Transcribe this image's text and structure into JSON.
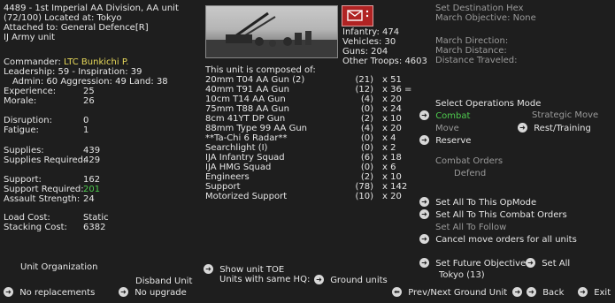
{
  "header": {
    "line1": "4489 - 1st Imperial AA Division, AA unit",
    "line2": "(72/100) Located at: Tokyo",
    "line3": "Attached to:  General Defence[R]",
    "line4": "IJ Army unit"
  },
  "commander": {
    "label": "Commander:",
    "name": "LTC Bunkichi P.",
    "leadership": "Leadership: 59 - Inspiration: 39",
    "admin": "Admin: 60  Aggression: 49 Land: 38"
  },
  "stats": [
    {
      "label": "Experience:",
      "value": "25"
    },
    {
      "label": "Morale:",
      "value": "26"
    }
  ],
  "stats2": [
    {
      "label": "Disruption:",
      "value": "0"
    },
    {
      "label": "Fatigue:",
      "value": "1"
    }
  ],
  "stats3": [
    {
      "label": "Supplies:",
      "value": "439"
    },
    {
      "label": "Supplies Required:",
      "value": "429"
    }
  ],
  "stats4": [
    {
      "label": "Support:",
      "value": "162"
    },
    {
      "label": "Support Required:",
      "value": "201"
    },
    {
      "label": "Assault Strength:",
      "value": "24"
    }
  ],
  "stats5": [
    {
      "label": "Load Cost:",
      "value": "Static"
    },
    {
      "label": "Stacking Cost:",
      "value": "6382"
    }
  ],
  "strength": {
    "infantry": "Infantry: 474",
    "vehicles": "Vehicles: 30",
    "guns": "Guns: 204",
    "other": "Other Troops: 4603"
  },
  "toe": {
    "title": "This unit is composed of:",
    "rows": [
      {
        "name": "20mm T04 AA Gun (2)",
        "count": "(21)",
        "qty": "x 51"
      },
      {
        "name": "40mm T91 AA Gun",
        "count": "(12)",
        "qty": "x 36 ="
      },
      {
        "name": "10cm T14 AA Gun",
        "count": "(4)",
        "qty": "x 20"
      },
      {
        "name": "75mm T88 AA Gun",
        "count": "(0)",
        "qty": "x 24"
      },
      {
        "name": "8cm 41YT DP Gun",
        "count": "(2)",
        "qty": "x 10"
      },
      {
        "name": "88mm Type 99 AA Gun",
        "count": "(4)",
        "qty": "x 20"
      },
      {
        "name": "**Ta-Chi 6 Radar**",
        "count": "(0)",
        "qty": "x 4"
      },
      {
        "name": "Searchlight (I)",
        "count": "(0)",
        "qty": "x 2"
      },
      {
        "name": "IJA Infantry Squad",
        "count": "(6)",
        "qty": "x 18"
      },
      {
        "name": "IJA HMG Squad",
        "count": "(0)",
        "qty": "x 6"
      },
      {
        "name": "Engineers",
        "count": "(2)",
        "qty": "x 10"
      },
      {
        "name": "Support",
        "count": "(78)",
        "qty": "x 142"
      },
      {
        "name": "Motorized Support",
        "count": "(10)",
        "qty": "x 20"
      }
    ]
  },
  "march": {
    "set_dest": "Set Destination Hex",
    "objective": "March Objective: None",
    "direction": "March Direction:",
    "distance": "March Distance:",
    "traveled": "Distance Traveled:"
  },
  "ops": {
    "title": "Select Operations Mode",
    "combat": "Combat",
    "move": "Move",
    "reserve": "Reserve",
    "strategic": "Strategic Move",
    "rest": "Rest/Training",
    "orders_title": "Combat Orders",
    "defend": "Defend"
  },
  "actions": {
    "set_opmode": "Set All To This OpMode",
    "set_combat": "Set All To This Combat Orders",
    "set_follow": "Set All To Follow",
    "cancel_move": "Cancel move orders for all units",
    "future_obj": "Set Future Objective",
    "set_all": "Set All",
    "tokyo": "Tokyo (13)"
  },
  "bottom": {
    "unit_org": "Unit Organization",
    "disband": "Disband Unit",
    "no_repl": "No replacements",
    "no_upgrade": "No upgrade",
    "show_toe": "Show unit TOE",
    "same_hq": "Units with same HQ:",
    "ground_units": "Ground units",
    "prev_next": "Prev/Next Ground Unit",
    "back": "Back",
    "exit": "Exit"
  },
  "colors": {
    "background": "#1e1e1e",
    "text": "#e6e6e6",
    "highlight": "#e8d95a",
    "green": "#4ecb4e",
    "dim": "#9a9a9a"
  }
}
